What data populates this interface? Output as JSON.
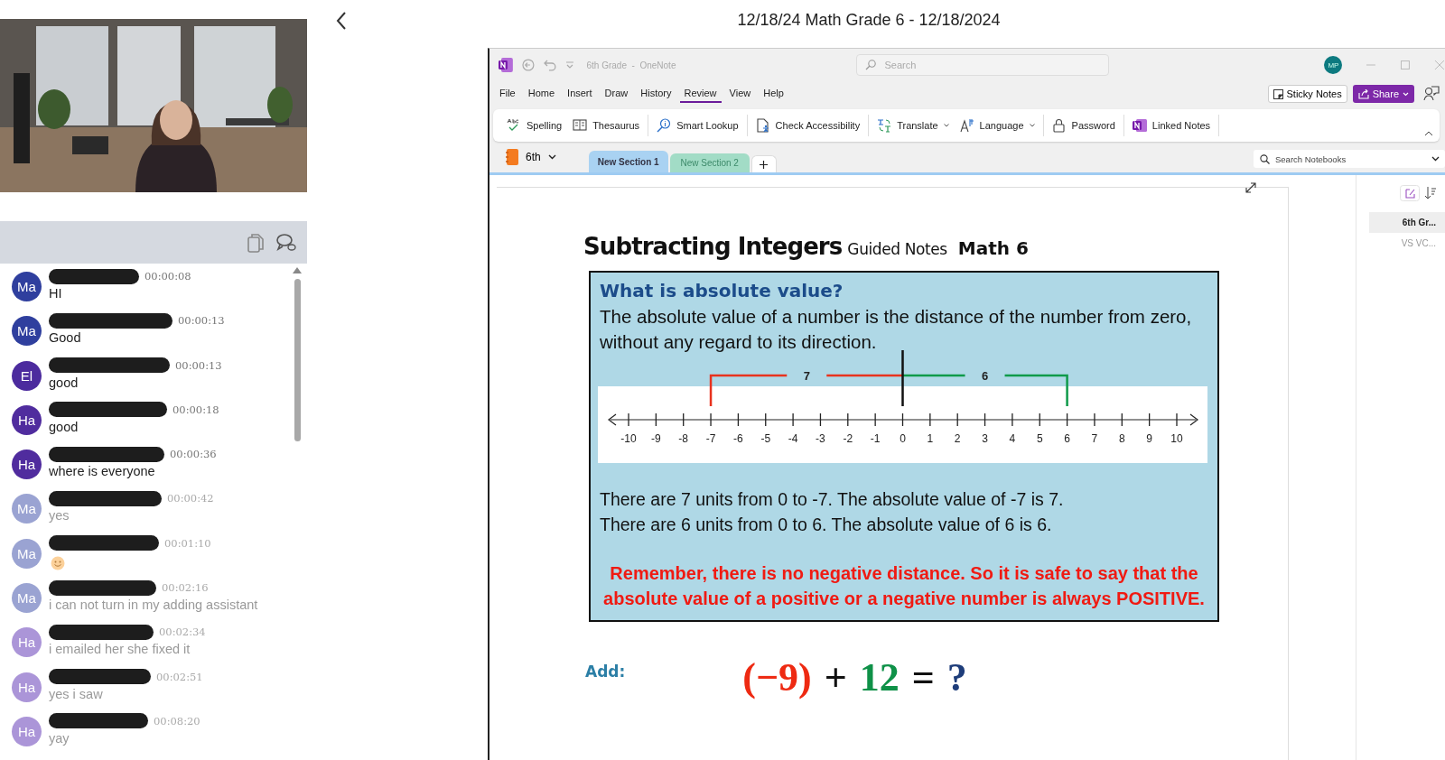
{
  "header": {
    "title": "12/18/24 Math Grade 6 - 12/18/2024"
  },
  "chat": {
    "messages": [
      {
        "initials": "Ma",
        "color": "#2f3f9e",
        "time": "00:00:08",
        "text": "HI",
        "dimmed": false,
        "kind": "text"
      },
      {
        "initials": "Ma",
        "color": "#2f3f9e",
        "time": "00:00:13",
        "text": "Good",
        "dimmed": false,
        "kind": "text"
      },
      {
        "initials": "El",
        "color": "#4c2b9e",
        "time": "00:00:13",
        "text": "good",
        "dimmed": false,
        "kind": "text"
      },
      {
        "initials": "Ha",
        "color": "#502c9e",
        "time": "00:00:18",
        "text": "good",
        "dimmed": false,
        "kind": "text"
      },
      {
        "initials": "Ha",
        "color": "#502c9e",
        "time": "00:00:36",
        "text": "where is everyone",
        "dimmed": false,
        "kind": "text"
      },
      {
        "initials": "Ma",
        "color": "#9aa3d2",
        "time": "00:00:42",
        "text": "yes",
        "dimmed": true,
        "kind": "text"
      },
      {
        "initials": "Ma",
        "color": "#9aa3d2",
        "time": "00:01:10",
        "dimmed": true,
        "kind": "emoji"
      },
      {
        "initials": "Ma",
        "color": "#9aa3d2",
        "time": "00:02:16",
        "text": "i can not turn in my adding assistant",
        "dimmed": true,
        "kind": "text"
      },
      {
        "initials": "Ha",
        "color": "#ab95d8",
        "time": "00:02:34",
        "text": "i emailed her she fixed it",
        "dimmed": true,
        "kind": "text"
      },
      {
        "initials": "Ha",
        "color": "#ab95d8",
        "time": "00:02:51",
        "text": "yes i saw",
        "dimmed": true,
        "kind": "text"
      },
      {
        "initials": "Ha",
        "color": "#ab95d8",
        "time": "00:08:20",
        "text": "yay",
        "dimmed": true,
        "kind": "text"
      }
    ]
  },
  "onenote": {
    "window_title": "6th Grade  -  OneNote",
    "search": {
      "placeholder": "Search"
    },
    "avatar": "MP",
    "menu": [
      {
        "label": "File",
        "selected": false
      },
      {
        "label": "Home",
        "selected": false
      },
      {
        "label": "Insert",
        "selected": false
      },
      {
        "label": "Draw",
        "selected": false
      },
      {
        "label": "History",
        "selected": false
      },
      {
        "label": "Review",
        "selected": true
      },
      {
        "label": "View",
        "selected": false
      },
      {
        "label": "Help",
        "selected": false
      }
    ],
    "sticky_notes": "Sticky Notes",
    "share": "Share",
    "ribbon": [
      [
        {
          "label": "Spelling",
          "kind": "spelling",
          "dropdown": false
        },
        {
          "label": "Thesaurus",
          "kind": "book",
          "dropdown": false
        }
      ],
      [
        {
          "label": "Smart Lookup",
          "kind": "lookup",
          "dropdown": false
        }
      ],
      [
        {
          "label": "Check Accessibility",
          "kind": "accessibility",
          "dropdown": false
        }
      ],
      [
        {
          "label": "Translate",
          "kind": "translate",
          "dropdown": true
        },
        {
          "label": "Language",
          "kind": "language",
          "dropdown": true
        }
      ],
      [
        {
          "label": "Password",
          "kind": "lock",
          "dropdown": false
        }
      ],
      [
        {
          "label": "Linked Notes",
          "kind": "onenote",
          "dropdown": false
        }
      ]
    ],
    "notebook": "6th",
    "sections": [
      {
        "label": "New Section 1",
        "selected": true,
        "color": "#a9d2f2"
      },
      {
        "label": "New Section 2",
        "selected": false,
        "color": "#a2dcc6"
      }
    ],
    "notebook_search": {
      "placeholder": "Search Notebooks"
    },
    "pages": [
      {
        "label": "6th Gr...",
        "selected": true
      },
      {
        "label": "VS VC...",
        "selected": false
      }
    ],
    "page": {
      "title": "Subtracting Integers",
      "subtitle": "Guided Notes",
      "course": "Math 6",
      "box": {
        "heading": "What is absolute value?",
        "definition": "The absolute value of a number is the distance of the number from zero, without any regard to its direction.",
        "number_line": {
          "ticks": [
            "-10",
            "-9",
            "-8",
            "-7",
            "-6",
            "-5",
            "-4",
            "-3",
            "-2",
            "-1",
            "0",
            "1",
            "2",
            "3",
            "4",
            "5",
            "6",
            "7",
            "8",
            "9",
            "10"
          ],
          "brackets": [
            {
              "kind": "negative",
              "label": "7",
              "color": "#e8321e"
            },
            {
              "kind": "positive",
              "label": "6",
              "color": "#0f9a4a"
            }
          ]
        },
        "examples": [
          "There are 7 units from 0 to -7. The absolute value of -7 is 7.",
          "There are 6 units from 0 to 6. The absolute value of 6 is 6."
        ],
        "remember": "Remember, there is no negative distance. So it is safe to say that the absolute value of a positive or a negative number is always POSITIVE."
      },
      "add_label": "Add:",
      "equation": [
        {
          "text": "(−9)",
          "color": "#ee2a12"
        },
        {
          "text": "+",
          "color": "#111111"
        },
        {
          "text": "12",
          "color": "#0f9148"
        },
        {
          "text": "=",
          "color": "#111111"
        },
        {
          "text": "?",
          "color": "#1e3d7a"
        }
      ]
    }
  }
}
